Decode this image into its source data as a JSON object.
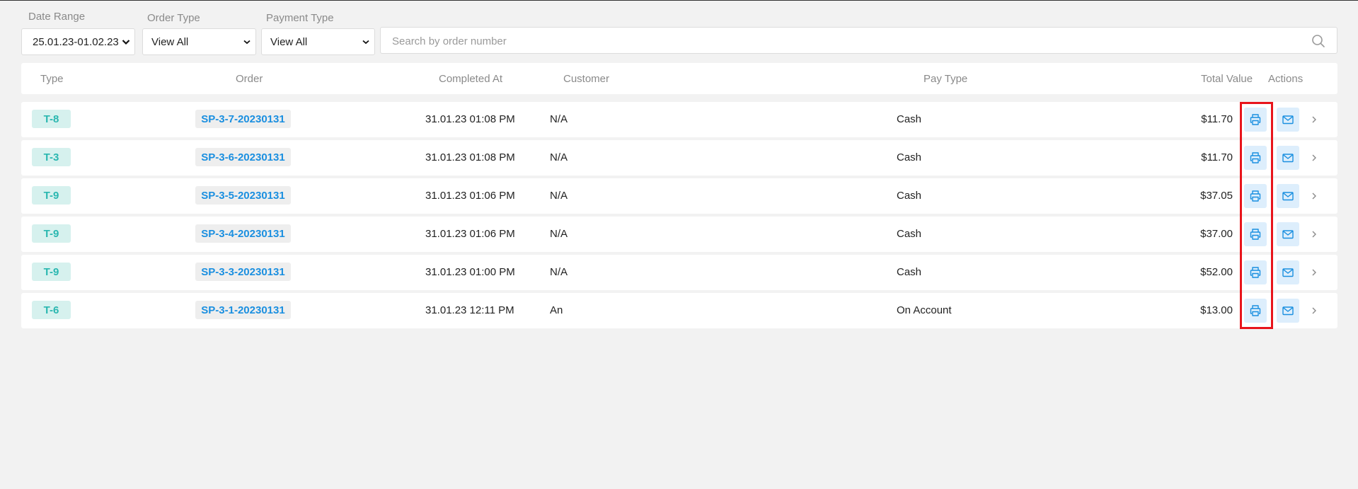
{
  "filters": {
    "date_range": {
      "label": "Date Range",
      "value": "25.01.23-01.02.23"
    },
    "order_type": {
      "label": "Order Type",
      "value": "View All"
    },
    "payment_type": {
      "label": "Payment Type",
      "value": "View All"
    },
    "search": {
      "placeholder": "Search by order number",
      "value": ""
    }
  },
  "table": {
    "headers": {
      "type": "Type",
      "order": "Order",
      "completed_at": "Completed At",
      "customer": "Customer",
      "pay_type": "Pay Type",
      "total_value": "Total Value",
      "actions": "Actions"
    },
    "rows": [
      {
        "type": "T-8",
        "order": "SP-3-7-20230131",
        "completed_at": "31.01.23 01:08 PM",
        "customer": "N/A",
        "pay_type": "Cash",
        "total_value": "$11.70"
      },
      {
        "type": "T-3",
        "order": "SP-3-6-20230131",
        "completed_at": "31.01.23 01:08 PM",
        "customer": "N/A",
        "pay_type": "Cash",
        "total_value": "$11.70"
      },
      {
        "type": "T-9",
        "order": "SP-3-5-20230131",
        "completed_at": "31.01.23 01:06 PM",
        "customer": "N/A",
        "pay_type": "Cash",
        "total_value": "$37.05"
      },
      {
        "type": "T-9",
        "order": "SP-3-4-20230131",
        "completed_at": "31.01.23 01:06 PM",
        "customer": "N/A",
        "pay_type": "Cash",
        "total_value": "$37.00"
      },
      {
        "type": "T-9",
        "order": "SP-3-3-20230131",
        "completed_at": "31.01.23 01:00 PM",
        "customer": "N/A",
        "pay_type": "Cash",
        "total_value": "$52.00"
      },
      {
        "type": "T-6",
        "order": "SP-3-1-20230131",
        "completed_at": "31.01.23 12:11 PM",
        "customer": "An",
        "pay_type": "On Account",
        "total_value": "$13.00"
      }
    ]
  },
  "icons": {
    "print": "printer-icon",
    "email": "mail-icon",
    "details": "chevron-right-icon",
    "search": "search-icon"
  },
  "colors": {
    "type_badge_bg": "#d6f1ee",
    "type_badge_text": "#2ab7b0",
    "order_badge_text": "#1a8fe0",
    "action_bg": "#ddeefc",
    "action_icon": "#1a8fe0",
    "highlight": "#e8141b"
  }
}
